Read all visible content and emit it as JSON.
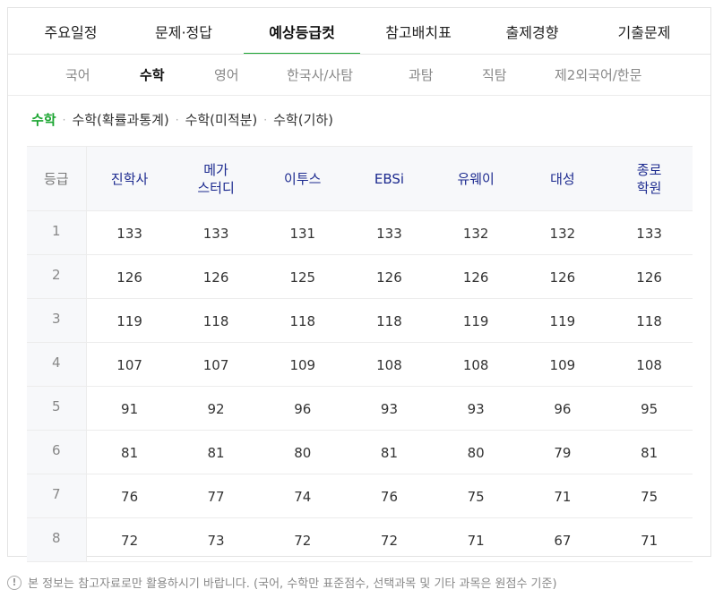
{
  "main_tabs": [
    {
      "label": "주요일정"
    },
    {
      "label": "문제·정답"
    },
    {
      "label": "예상등급컷",
      "active": true
    },
    {
      "label": "참고배치표"
    },
    {
      "label": "출제경향"
    },
    {
      "label": "기출문제"
    }
  ],
  "sub_tabs": [
    {
      "label": "국어"
    },
    {
      "label": "수학",
      "active": true
    },
    {
      "label": "영어"
    },
    {
      "label": "한국사/사탐"
    },
    {
      "label": "과탐"
    },
    {
      "label": "직탐"
    },
    {
      "label": "제2외국어/한문"
    }
  ],
  "filters": [
    {
      "label": "수학",
      "active": true
    },
    {
      "label": "수학(확률과통계)"
    },
    {
      "label": "수학(미적분)"
    },
    {
      "label": "수학(기하)"
    }
  ],
  "filter_separator": "·",
  "table": {
    "grade_header": "등급",
    "columns": [
      {
        "line1": "진학사",
        "line2": ""
      },
      {
        "line1": "메가",
        "line2": "스터디"
      },
      {
        "line1": "이투스",
        "line2": ""
      },
      {
        "line1": "EBSi",
        "line2": ""
      },
      {
        "line1": "유웨이",
        "line2": ""
      },
      {
        "line1": "대성",
        "line2": ""
      },
      {
        "line1": "종로",
        "line2": "학원"
      }
    ],
    "rows": [
      {
        "grade": "1",
        "values": [
          "133",
          "133",
          "131",
          "133",
          "132",
          "132",
          "133"
        ]
      },
      {
        "grade": "2",
        "values": [
          "126",
          "126",
          "125",
          "126",
          "126",
          "126",
          "126"
        ]
      },
      {
        "grade": "3",
        "values": [
          "119",
          "118",
          "118",
          "118",
          "119",
          "119",
          "118"
        ]
      },
      {
        "grade": "4",
        "values": [
          "107",
          "107",
          "109",
          "108",
          "108",
          "109",
          "108"
        ]
      },
      {
        "grade": "5",
        "values": [
          "91",
          "92",
          "96",
          "93",
          "93",
          "96",
          "95"
        ]
      },
      {
        "grade": "6",
        "values": [
          "81",
          "81",
          "80",
          "81",
          "80",
          "79",
          "81"
        ]
      },
      {
        "grade": "7",
        "values": [
          "76",
          "77",
          "74",
          "76",
          "75",
          "71",
          "75"
        ]
      },
      {
        "grade": "8",
        "values": [
          "72",
          "73",
          "72",
          "72",
          "71",
          "67",
          "71"
        ]
      }
    ]
  },
  "notice": {
    "icon": "!",
    "text": "본 정보는 참고자료로만 활용하시기 바랍니다. (국어, 수학만 표준점수, 선택과목 및 기타 과목은 원점수 기준)"
  },
  "colors": {
    "accent": "#1ba531",
    "header_text": "#1c2a8f"
  }
}
